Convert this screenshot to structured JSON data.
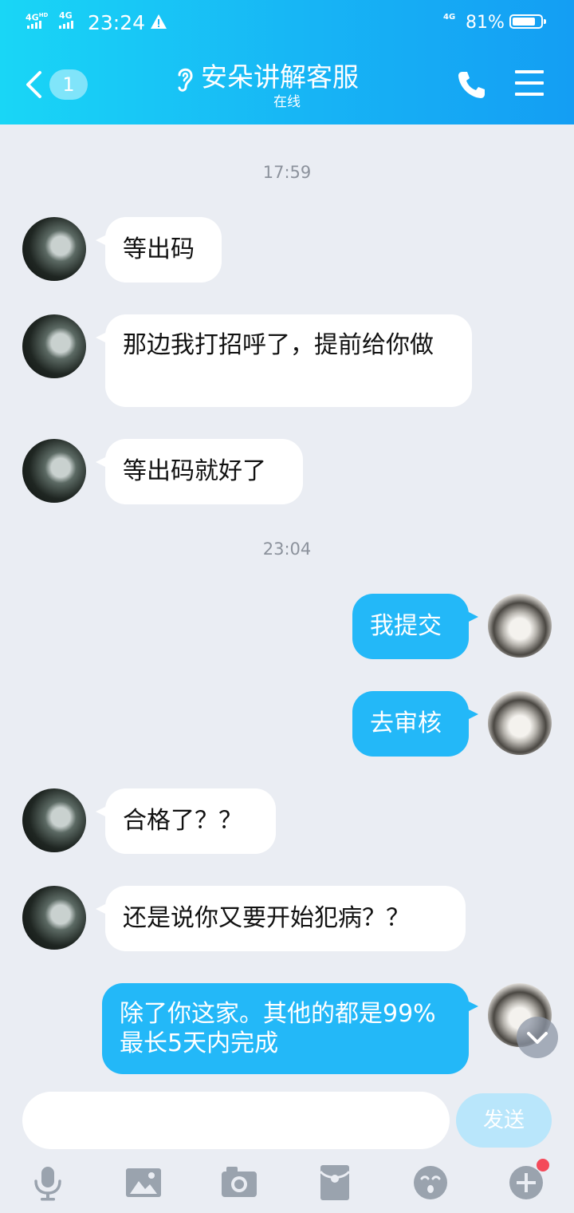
{
  "status_bar": {
    "sim1": "4G",
    "sim1_sup": "HD",
    "sim2": "4G",
    "time": "23:24",
    "network": "4G",
    "battery": "81%"
  },
  "header": {
    "unread_count": "1",
    "title": "安朵讲解客服",
    "subtitle": "在线",
    "icons": [
      "back-arrow-icon",
      "ear-icon",
      "phone-icon",
      "menu-icon"
    ]
  },
  "timestamps": [
    "17:59",
    "23:04"
  ],
  "messages": [
    {
      "side": "left",
      "text": "等出码"
    },
    {
      "side": "left",
      "text": "那边我打招呼了，提前给你做"
    },
    {
      "side": "left",
      "text": "等出码就好了"
    },
    {
      "side": "right",
      "text": "我提交"
    },
    {
      "side": "right",
      "text": "去审核"
    },
    {
      "side": "left",
      "text": "合格了？？"
    },
    {
      "side": "left",
      "text": "还是说你又要开始犯病？？"
    },
    {
      "side": "right",
      "text": "除了你这家。其他的都是99%最长5天内完成"
    }
  ],
  "input": {
    "value": "",
    "send_label": "发送"
  },
  "toolbar": {
    "icons": [
      "microphone-icon",
      "image-icon",
      "camera-icon",
      "red-packet-icon",
      "emoji-icon",
      "plus-icon"
    ]
  },
  "colors": {
    "accent": "#17b4f5",
    "bubble_right": "#23b8f8",
    "background": "#eaedf3"
  }
}
